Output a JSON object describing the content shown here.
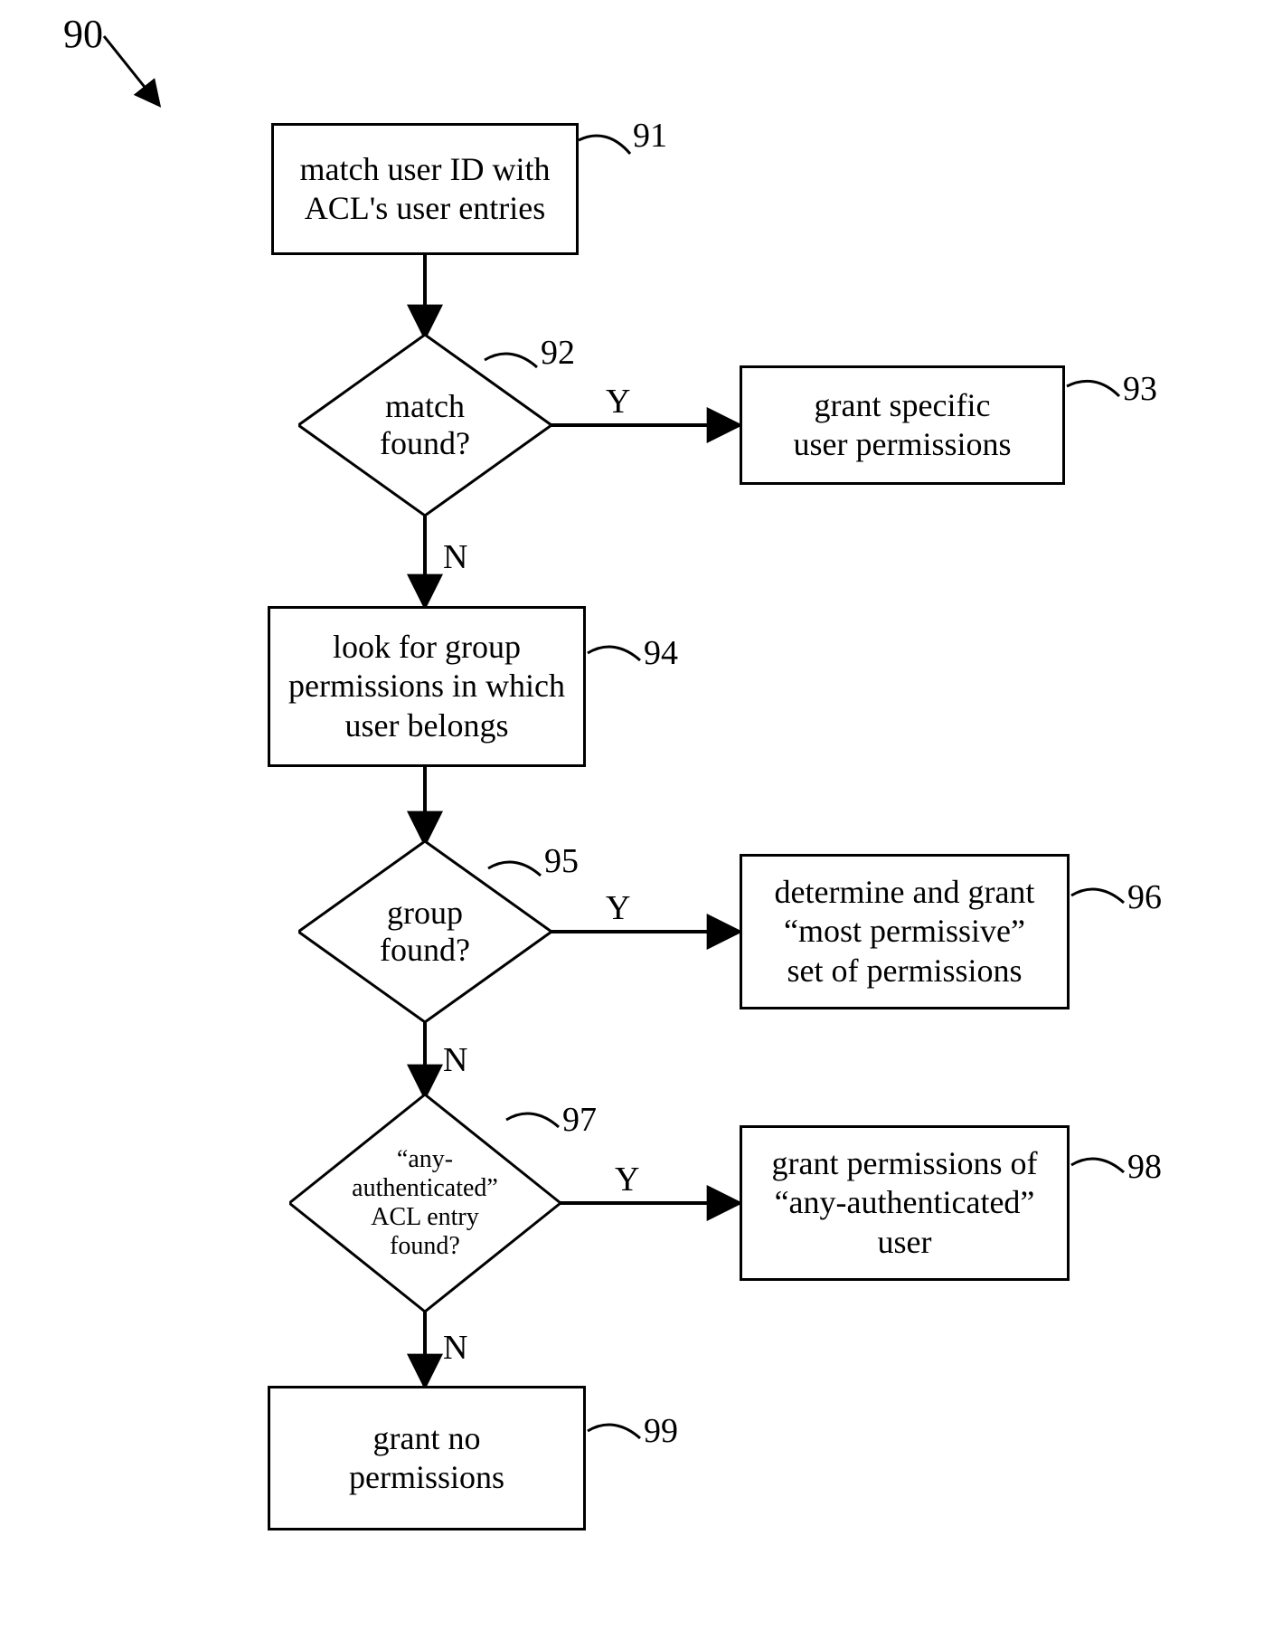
{
  "diagramRef": "90",
  "nodes": {
    "n91": {
      "text": "match user ID with\nACL's user entries",
      "ref": "91"
    },
    "n92": {
      "text": "match\nfound?",
      "ref": "92"
    },
    "n93": {
      "text": "grant specific\nuser permissions",
      "ref": "93"
    },
    "n94": {
      "text": "look for group\npermissions in which\nuser belongs",
      "ref": "94"
    },
    "n95": {
      "text": "group\nfound?",
      "ref": "95"
    },
    "n96": {
      "text": "determine and grant\n“most permissive”\nset of permissions",
      "ref": "96"
    },
    "n97": {
      "text": "“any-\nauthenticated”\nACL entry\nfound?",
      "ref": "97"
    },
    "n98": {
      "text": "grant permissions of\n“any-authenticated”\nuser",
      "ref": "98"
    },
    "n99": {
      "text": "grant no\npermissions",
      "ref": "99"
    }
  },
  "edges": {
    "y": "Y",
    "n": "N"
  }
}
